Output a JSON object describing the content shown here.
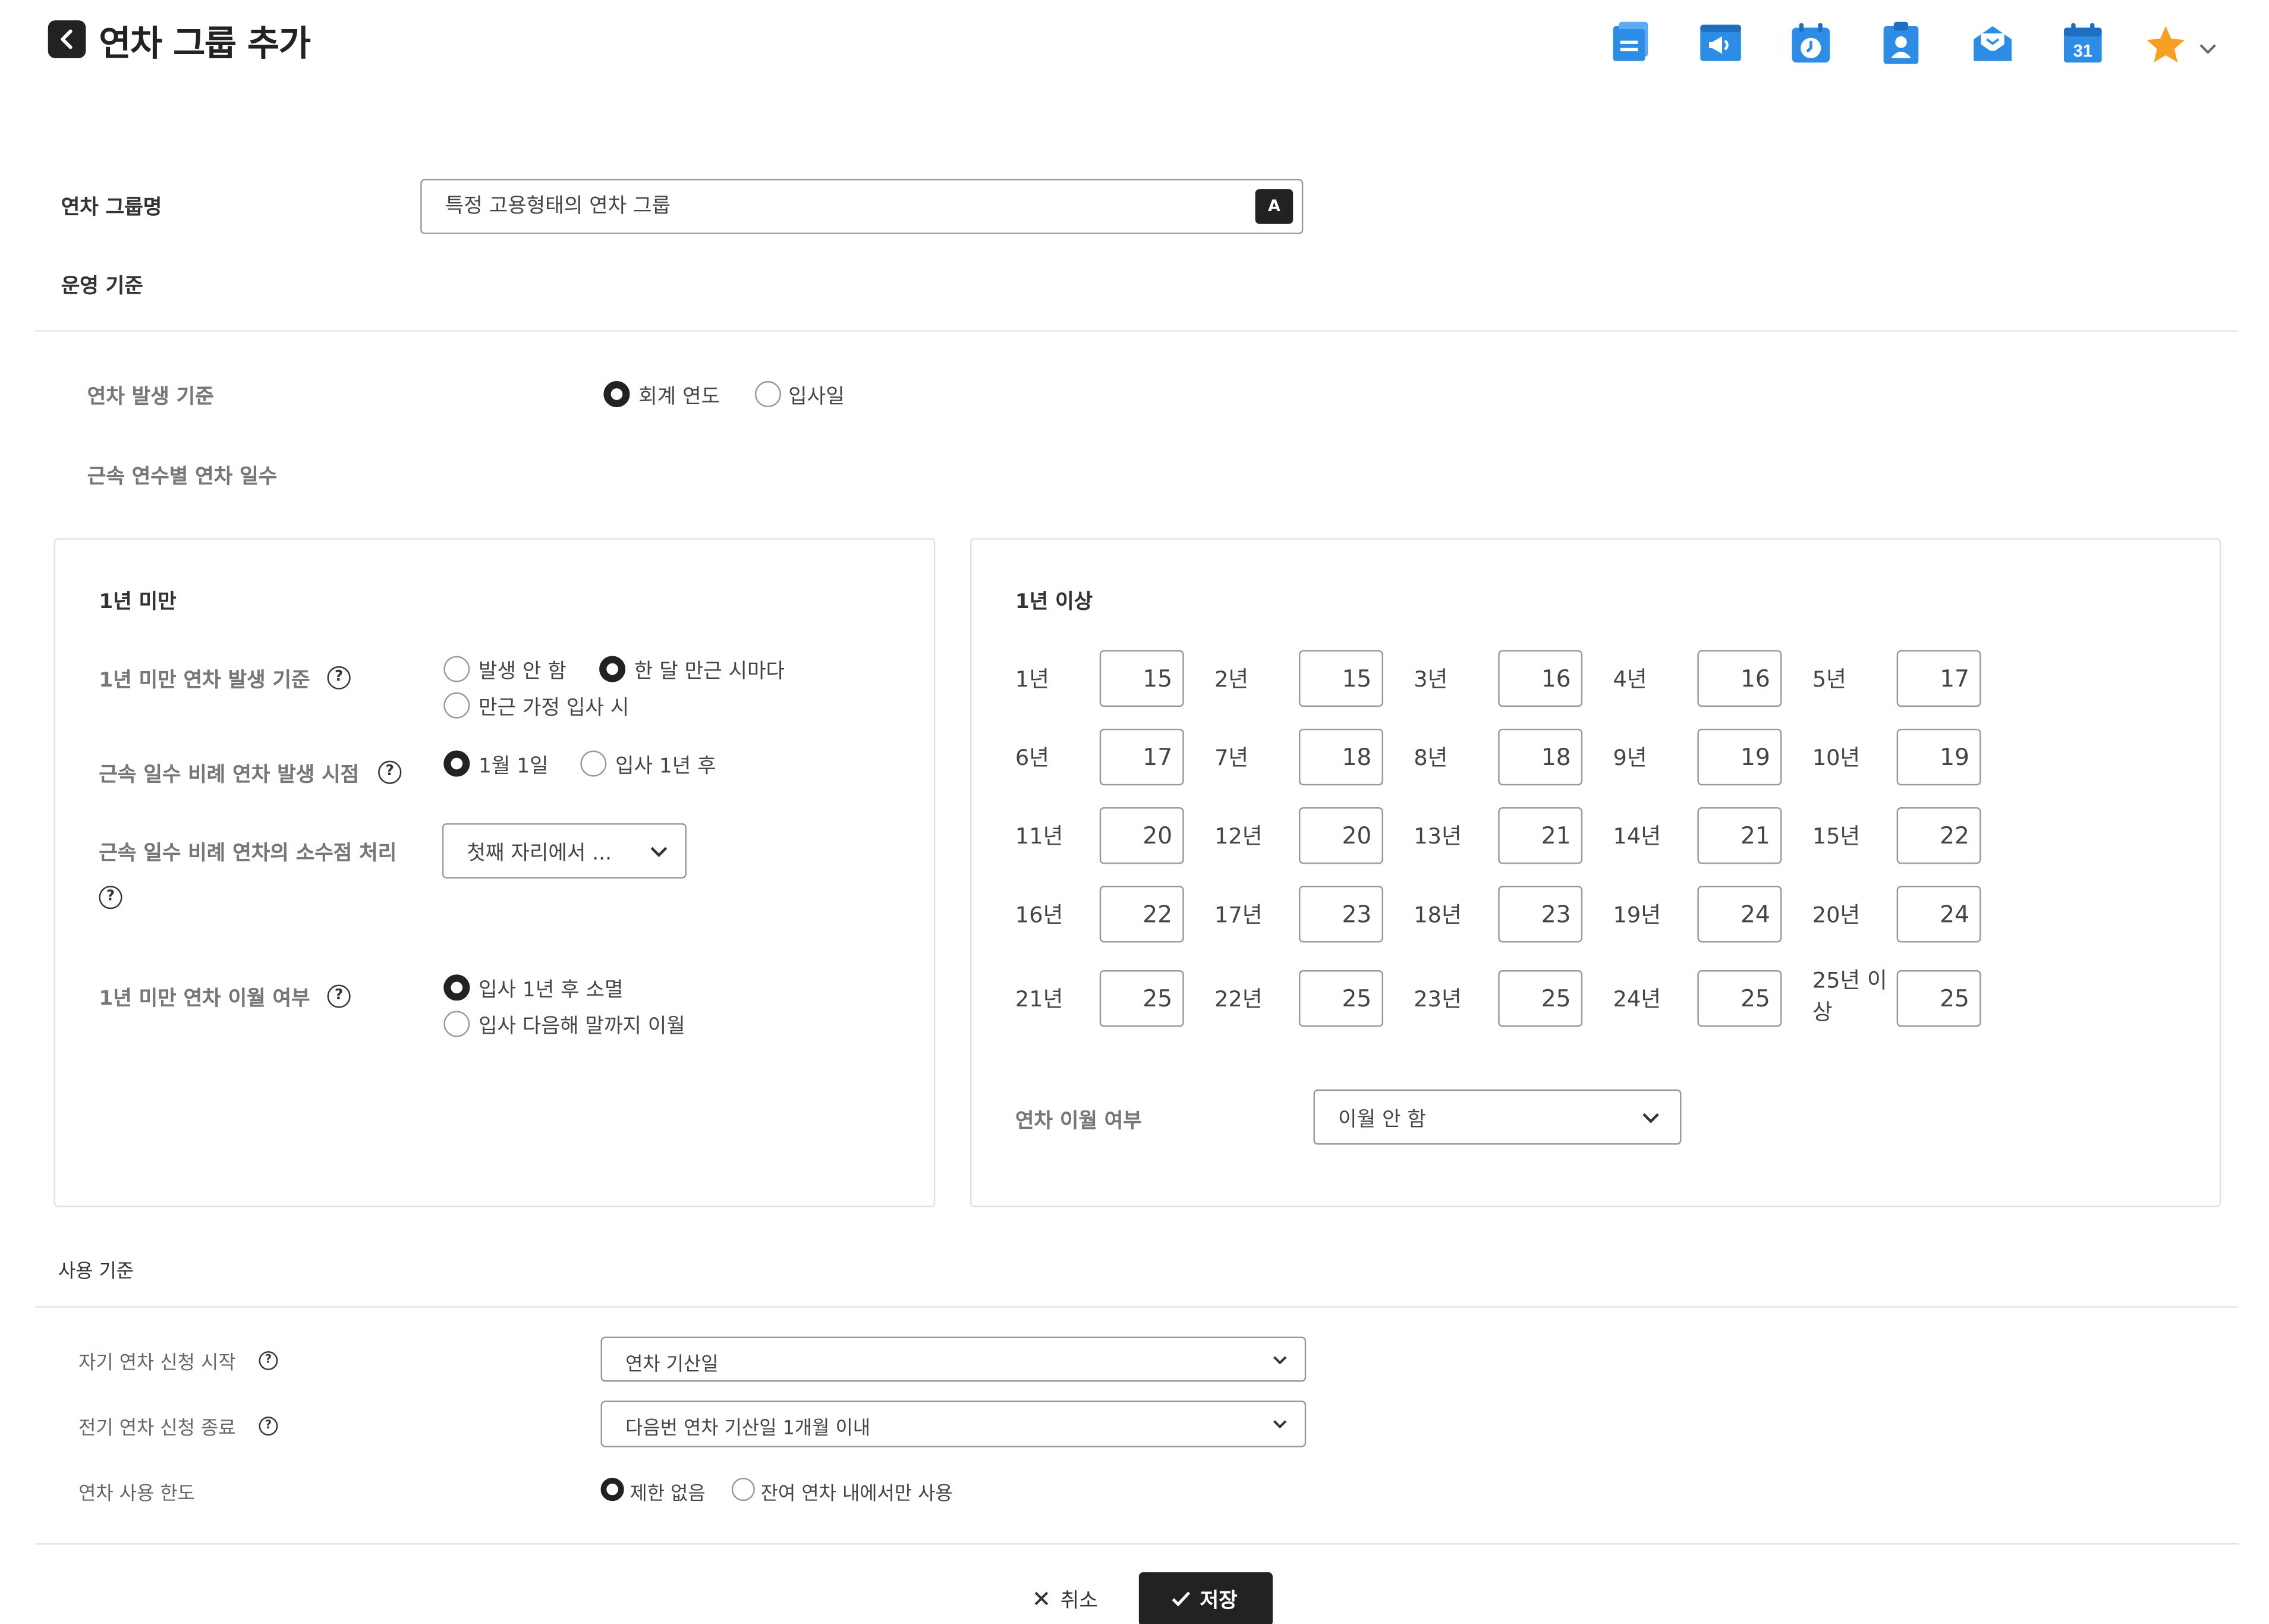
{
  "header": {
    "title": "연차 그룹 추가",
    "icons": [
      "board-icon",
      "notice-icon",
      "clock-calendar-icon",
      "contact-icon",
      "mail-icon",
      "calendar-31-icon",
      "star-icon"
    ],
    "calendar_day": "31",
    "icon_color": "#2d8ce6",
    "star_color": "#f5a023"
  },
  "group_name": {
    "label": "연차 그룹명",
    "value": "특정 고용형태의 연차 그룹",
    "badge": "A"
  },
  "operation": {
    "section_title": "운영 기준",
    "occurrence_basis": {
      "label": "연차 발생 기준",
      "options": [
        "회계 연도",
        "입사일"
      ],
      "selected": "회계 연도"
    },
    "by_years_title": "근속 연수별 연차 일수"
  },
  "under_one_year": {
    "title": "1년 미만",
    "basis": {
      "label": "1년 미만 연차 발생 기준",
      "options": [
        "발생 안 함",
        "한 달 만근 시마다",
        "만근 가정 입사 시"
      ],
      "selected": "한 달 만근 시마다"
    },
    "proportional_timing": {
      "label": "근속 일수 비례 연차 발생 시점",
      "options": [
        "1월 1일",
        "입사 1년 후"
      ],
      "selected": "1월 1일"
    },
    "decimal_handling": {
      "label": "근속 일수 비례 연차의 소수점 처리",
      "value": "첫째 자리에서 ..."
    },
    "carryover": {
      "label": "1년 미만 연차 이월 여부",
      "options": [
        "입사 1년 후 소멸",
        "입사 다음해 말까지 이월"
      ],
      "selected": "입사 1년 후 소멸"
    }
  },
  "over_one_year": {
    "title": "1년 이상",
    "years": [
      {
        "label": "1년",
        "days": "15"
      },
      {
        "label": "2년",
        "days": "15"
      },
      {
        "label": "3년",
        "days": "16"
      },
      {
        "label": "4년",
        "days": "16"
      },
      {
        "label": "5년",
        "days": "17"
      },
      {
        "label": "6년",
        "days": "17"
      },
      {
        "label": "7년",
        "days": "18"
      },
      {
        "label": "8년",
        "days": "18"
      },
      {
        "label": "9년",
        "days": "19"
      },
      {
        "label": "10년",
        "days": "19"
      },
      {
        "label": "11년",
        "days": "20"
      },
      {
        "label": "12년",
        "days": "20"
      },
      {
        "label": "13년",
        "days": "21"
      },
      {
        "label": "14년",
        "days": "21"
      },
      {
        "label": "15년",
        "days": "22"
      },
      {
        "label": "16년",
        "days": "22"
      },
      {
        "label": "17년",
        "days": "23"
      },
      {
        "label": "18년",
        "days": "23"
      },
      {
        "label": "19년",
        "days": "24"
      },
      {
        "label": "20년",
        "days": "24"
      },
      {
        "label": "21년",
        "days": "25"
      },
      {
        "label": "22년",
        "days": "25"
      },
      {
        "label": "23년",
        "days": "25"
      },
      {
        "label": "24년",
        "days": "25"
      },
      {
        "label": "25년 이상",
        "days": "25"
      }
    ],
    "carryover": {
      "label": "연차 이월 여부",
      "value": "이월 안 함"
    }
  },
  "usage": {
    "section_title": "사용 기준",
    "early_start": {
      "label": "자기 연차 신청 시작",
      "value": "연차 기산일"
    },
    "early_end": {
      "label": "전기 연차 신청 종료",
      "value": "다음번 연차 기산일 1개월 이내"
    },
    "limit": {
      "label": "연차 사용 한도",
      "options": [
        "제한 없음",
        "잔여 연차 내에서만 사용"
      ],
      "selected": "제한 없음"
    }
  },
  "footer": {
    "cancel_label": "취소",
    "save_label": "저장"
  }
}
